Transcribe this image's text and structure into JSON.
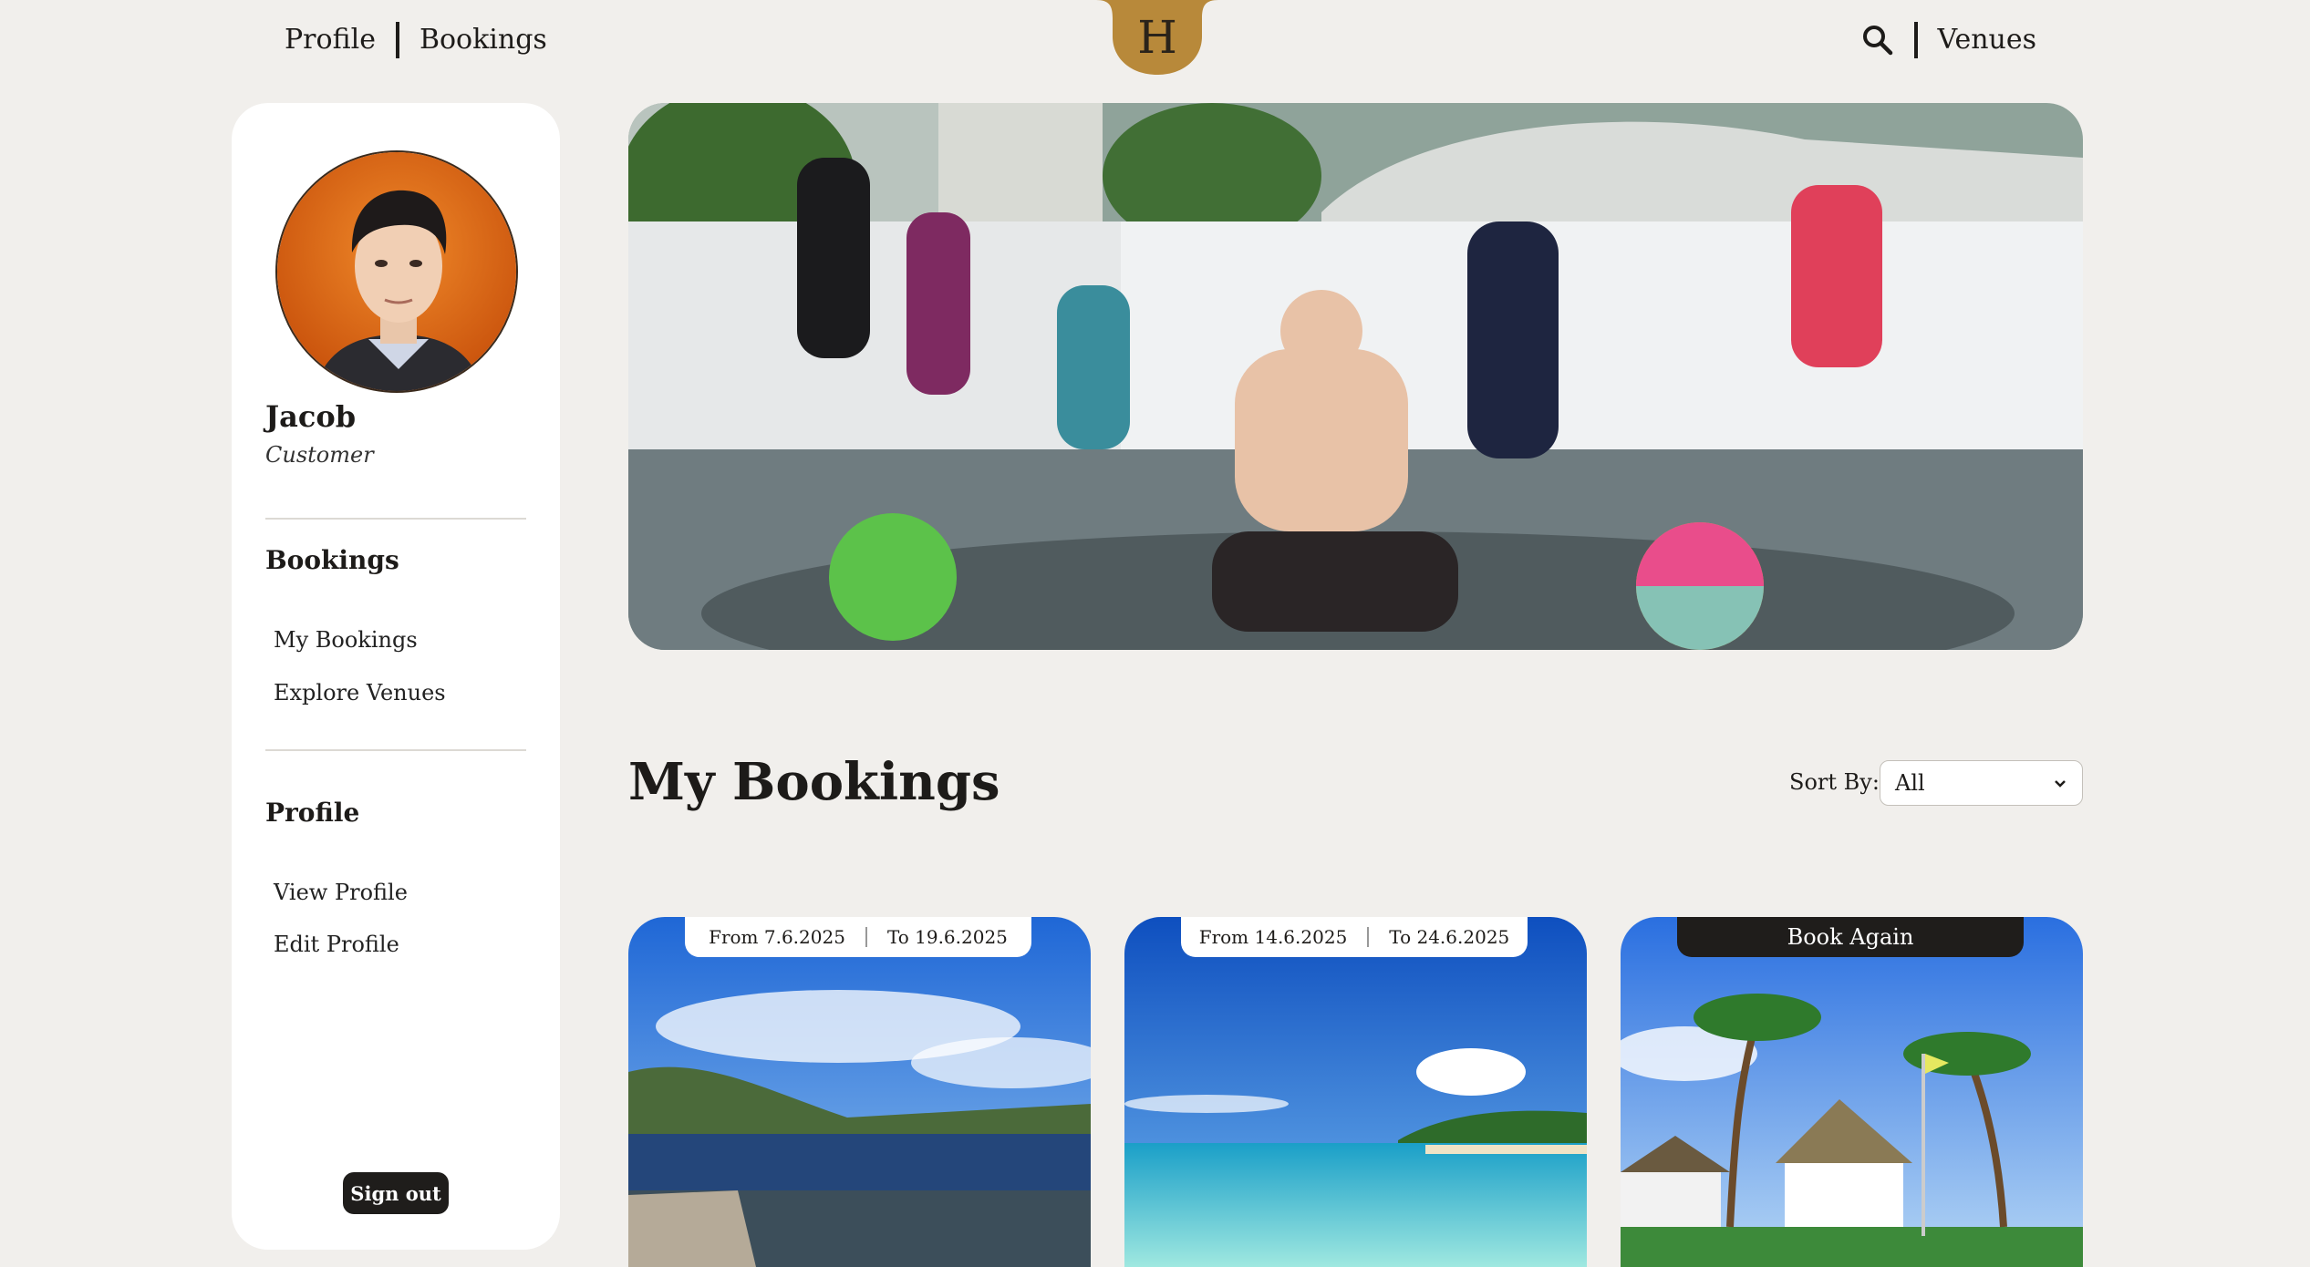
{
  "nav": {
    "profile_label": "Profile",
    "bookings_label": "Bookings",
    "logo_letter": "H",
    "venues_label": "Venues",
    "search_icon": "search-icon"
  },
  "colors": {
    "background": "#f1efec",
    "logo_gold": "#b8893a",
    "dark": "#1f1d1b",
    "panel": "#ffffff"
  },
  "sidebar": {
    "user_name": "Jacob",
    "user_role": "Customer",
    "sections": [
      {
        "heading": "Bookings",
        "items": [
          "My Bookings",
          "Explore Venues"
        ]
      },
      {
        "heading": "Profile",
        "items": [
          "View Profile",
          "Edit Profile"
        ]
      }
    ],
    "signout_label": "Sign out"
  },
  "main": {
    "title": "My Bookings",
    "sort_label": "Sort By:",
    "sort_value": "All"
  },
  "bookings": [
    {
      "from": "From 7.6.2025",
      "to": "To 19.6.2025"
    },
    {
      "from": "From 14.6.2025",
      "to": "To 24.6.2025"
    },
    {
      "action": "Book Again"
    }
  ]
}
